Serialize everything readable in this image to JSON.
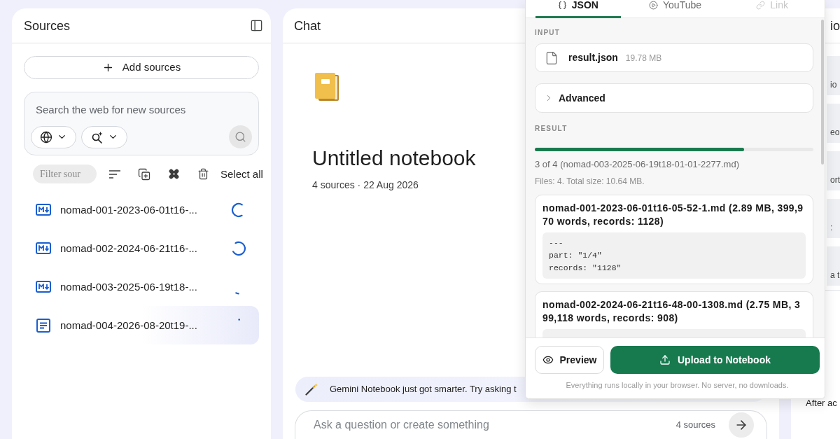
{
  "sources_panel": {
    "title": "Sources",
    "add_button": "Add sources",
    "web_search": {
      "placeholder": "Search the web for new sources"
    },
    "filter": {
      "placeholder": "Filter sour"
    },
    "select_all": "Select all",
    "sources": [
      {
        "kind": "markdown",
        "name": "nomad-001-2023-06-01t16-...",
        "loading": true,
        "hovered": false
      },
      {
        "kind": "markdown",
        "name": "nomad-002-2024-06-21t16-...",
        "loading": true,
        "hovered": false
      },
      {
        "kind": "markdown",
        "name": "nomad-003-2025-06-19t18-...",
        "loading": true,
        "hovered": false
      },
      {
        "kind": "document",
        "name": "nomad-004-2026-08-20t19-...",
        "loading": true,
        "hovered": true
      }
    ]
  },
  "chat_panel": {
    "title": "Chat",
    "notebook_title": "Untitled notebook",
    "notebook_meta": "4 sources · 22 Aug 2026",
    "tip": "Gemini Notebook just got smarter. Try asking t",
    "input": {
      "placeholder": "Ask a question or create something"
    },
    "source_count": "4 sources"
  },
  "studio_panel": {
    "title": "io",
    "tiles": [
      {
        "label": "io"
      },
      {
        "label": "eo"
      },
      {
        "label": "ort"
      },
      {
        "label": ":"
      },
      {
        "label": "a t"
      }
    ],
    "note": "After ac"
  },
  "import_dialog": {
    "tabs": [
      {
        "kind": "json",
        "label": "JSON",
        "selected": true,
        "disabled": false
      },
      {
        "kind": "video",
        "label": "YouTube",
        "selected": false,
        "disabled": false
      },
      {
        "kind": "link",
        "label": "Link",
        "selected": false,
        "disabled": true
      }
    ],
    "input_label": "INPUT",
    "file": {
      "name": "result.json",
      "size": "19.78 MB"
    },
    "advanced": {
      "label": "Advanced",
      "expanded": false
    },
    "result_label": "RESULT",
    "progress": {
      "level": 0.75
    },
    "status": "3 of 4 (nomad-003-2025-06-19t18-01-01-2277.md)",
    "summary": "Files: 4. Total size: 10.64 MB.",
    "results": [
      {
        "title": "nomad-001-2023-06-01t16-05-52-1.md (2.89 MB, 399,970 words, records: 1128)",
        "code": [
          "---",
          "part: \"1/4\"",
          "records: \"1128\""
        ]
      },
      {
        "title": "nomad-002-2024-06-21t16-48-00-1308.md (2.75 MB, 399,118 words, records: 908)"
      }
    ],
    "buttons": {
      "preview": "Preview",
      "upload": "Upload to Notebook"
    },
    "footnote": "Everything runs locally in your browser. No server, no downloads."
  }
}
